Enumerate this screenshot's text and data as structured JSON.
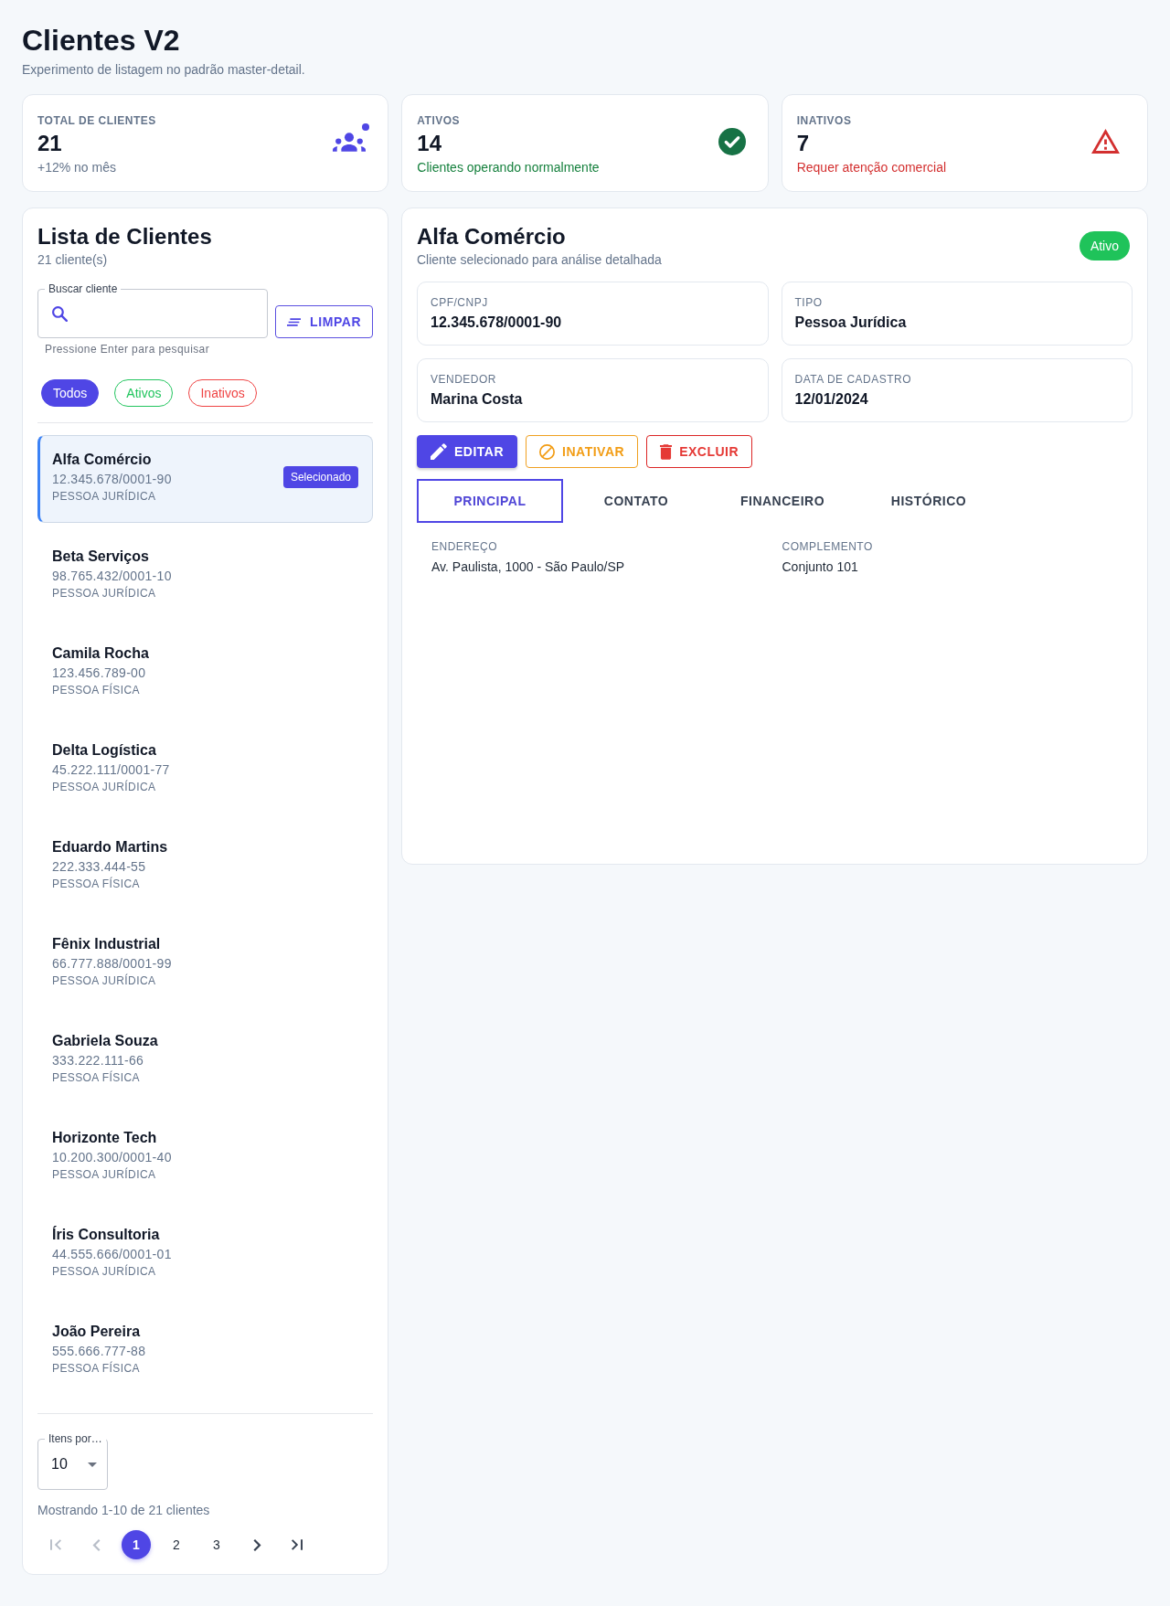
{
  "header": {
    "title": "Clientes V2",
    "subtitle": "Experimento de listagem no padrão master-detail."
  },
  "stats": [
    {
      "kind": "total",
      "label": "TOTAL DE CLIENTES",
      "value": "21",
      "note": "+12% no mês",
      "dot": true
    },
    {
      "kind": "active",
      "label": "ATIVOS",
      "value": "14",
      "note": "Clientes operando normalmente",
      "dot": false
    },
    {
      "kind": "inactive",
      "label": "INATIVOS",
      "value": "7",
      "note": "Requer atenção comercial",
      "dot": false
    }
  ],
  "client_list": {
    "title": "Lista de Clientes",
    "count": "21 cliente(s)",
    "search": {
      "label": "Buscar cliente",
      "helper": "Pressione Enter para pesquisar"
    },
    "clear_button": "LIMPAR",
    "filters": [
      {
        "label": "Todos",
        "color": "#4f46e5",
        "selected": true
      },
      {
        "label": "Ativos",
        "color": "#22c55e",
        "selected": false
      },
      {
        "label": "Inativos",
        "color": "#ef4444",
        "selected": false
      }
    ],
    "items": [
      {
        "name": "Alfa Comércio",
        "document": "12.345.678/0001-90",
        "type": "PESSOA JURÍDICA",
        "selected": true,
        "badge": "Selecionado"
      },
      {
        "name": "Beta Serviços",
        "document": "98.765.432/0001-10",
        "type": "PESSOA JURÍDICA",
        "selected": false
      },
      {
        "name": "Camila Rocha",
        "document": "123.456.789-00",
        "type": "PESSOA FÍSICA",
        "selected": false
      },
      {
        "name": "Delta Logística",
        "document": "45.222.111/0001-77",
        "type": "PESSOA JURÍDICA",
        "selected": false
      },
      {
        "name": "Eduardo Martins",
        "document": "222.333.444-55",
        "type": "PESSOA FÍSICA",
        "selected": false
      },
      {
        "name": "Fênix Industrial",
        "document": "66.777.888/0001-99",
        "type": "PESSOA JURÍDICA",
        "selected": false
      },
      {
        "name": "Gabriela Souza",
        "document": "333.222.111-66",
        "type": "PESSOA FÍSICA",
        "selected": false
      },
      {
        "name": "Horizonte Tech",
        "document": "10.200.300/0001-40",
        "type": "PESSOA JURÍDICA",
        "selected": false
      },
      {
        "name": "Íris Consultoria",
        "document": "44.555.666/0001-01",
        "type": "PESSOA JURÍDICA",
        "selected": false
      },
      {
        "name": "João Pereira",
        "document": "555.666.777-88",
        "type": "PESSOA FÍSICA",
        "selected": false
      }
    ],
    "page_size": {
      "label": "Itens por…",
      "value": "10"
    },
    "summary": "Mostrando 1-10 de 21 clientes",
    "pagination": {
      "first": {
        "disabled": true
      },
      "previous": {
        "disabled": true
      },
      "pages": [
        {
          "label": "1",
          "selected": true
        },
        {
          "label": "2",
          "selected": false
        },
        {
          "label": "3",
          "selected": false
        }
      ],
      "next": {
        "disabled": false
      },
      "last": {
        "disabled": false
      }
    }
  },
  "detail": {
    "title": "Alfa Comércio",
    "subtitle": "Cliente selecionado para análise detalhada",
    "status": {
      "kind": "active",
      "label": "Ativo"
    },
    "fields": [
      {
        "label": "CPF/CNPJ",
        "value": "12.345.678/0001-90"
      },
      {
        "label": "TIPO",
        "value": "Pessoa Jurídica"
      },
      {
        "label": "VENDEDOR",
        "value": "Marina Costa"
      },
      {
        "label": "DATA DE CADASTRO",
        "value": "12/01/2024"
      }
    ],
    "actions": [
      {
        "kind": "edit",
        "label": "EDITAR"
      },
      {
        "kind": "deactivate",
        "label": "INATIVAR"
      },
      {
        "kind": "delete",
        "label": "EXCLUIR"
      }
    ],
    "tabs": [
      {
        "label": "PRINCIPAL",
        "selected": true
      },
      {
        "label": "CONTATO",
        "selected": false
      },
      {
        "label": "FINANCEIRO",
        "selected": false
      },
      {
        "label": "HISTÓRICO",
        "selected": false
      }
    ],
    "tab_content": [
      {
        "label": "ENDEREÇO",
        "value": "Av. Paulista, 1000 - São Paulo/SP"
      },
      {
        "label": "COMPLEMENTO",
        "value": "Conjunto 101"
      }
    ]
  }
}
